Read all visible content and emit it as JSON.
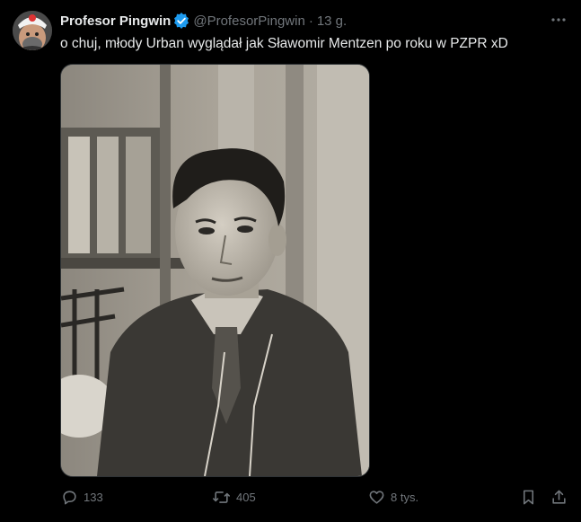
{
  "tweet": {
    "author_name": "Profesor Pingwin",
    "author_handle": "@ProfesorPingwin",
    "separator": "·",
    "time": "13 g.",
    "text": "o chuj, młody Urban wyglądał jak Sławomir Mentzen po roku w PZPR xD",
    "media": {
      "description": "black-and-white photo of a young man in a zip jacket and tie"
    },
    "replies": "133",
    "retweets": "405",
    "likes": "8 tys."
  },
  "icons": {
    "verified": "verified-badge-icon",
    "more": "more-dots-icon",
    "reply": "reply-icon",
    "retweet": "retweet-icon",
    "like": "heart-icon",
    "bookmark": "bookmark-icon",
    "share": "share-icon"
  },
  "colors": {
    "background": "#000000",
    "text": "#e7e9ea",
    "muted": "#71767b",
    "verified": "#1d9bf0"
  }
}
